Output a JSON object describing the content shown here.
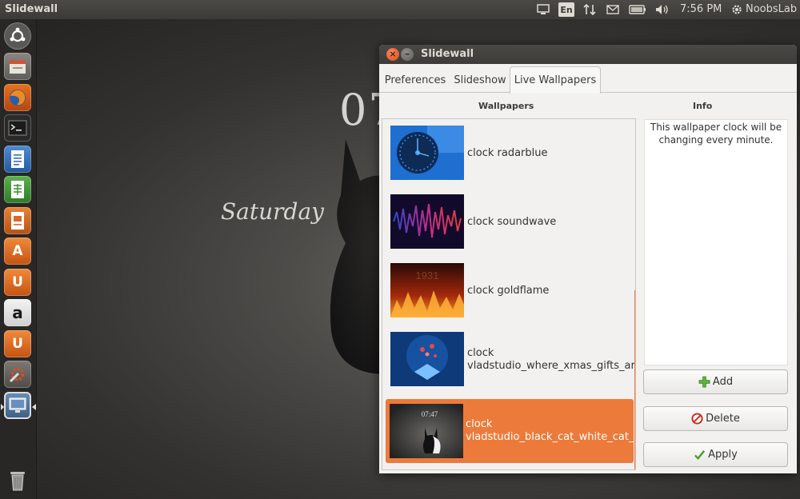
{
  "top_panel": {
    "app_name": "Slidewall",
    "keyboard_layout": "En",
    "time": "7:56 PM",
    "user": "NoobsLab",
    "icons": [
      "monitor-icon",
      "keyboard-icon",
      "network-icon",
      "mail-icon",
      "battery-icon",
      "volume-icon",
      "gear-icon"
    ]
  },
  "desktop": {
    "clock_text": "07",
    "day_text": "Saturday"
  },
  "launcher": {
    "items": [
      "dash-icon",
      "files-icon",
      "firefox-icon",
      "terminal-icon",
      "writer-icon",
      "calc-icon",
      "impress-icon",
      "software-center-icon",
      "ubuntu-one-icon",
      "amazon-icon",
      "ubuntu-one-music-icon",
      "system-settings-icon",
      "slidewall-icon",
      "trash-icon"
    ],
    "amazon_letter": "a",
    "u_letter": "U",
    "store_letter": "A"
  },
  "window": {
    "title": "Slidewall",
    "close_glyph": "×",
    "min_glyph": "–",
    "tabs": [
      {
        "label": "Preferences"
      },
      {
        "label": "Slideshow"
      },
      {
        "label": "Live Wallpapers",
        "active": true
      }
    ],
    "wallpapers_heading": "Wallpapers",
    "info_heading": "Info",
    "wallpapers": [
      {
        "label": "clock radarblue"
      },
      {
        "label": "clock soundwave"
      },
      {
        "label": "clock goldflame",
        "thumb_text": "1931"
      },
      {
        "label": "clock\nvladstudio_where_xmas_gifts_are"
      },
      {
        "label": "clock\nvladstudio_black_cat_white_cat_c",
        "selected": true,
        "thumb_text": "07:47"
      }
    ],
    "info_text": "This wallpaper clock will be changing every minute.",
    "buttons": {
      "add": "Add",
      "delete": "Delete",
      "apply": "Apply"
    }
  },
  "colors": {
    "accent": "#ec7a3b",
    "panel": "#3c3b37",
    "window_bg": "#f2f1f0"
  }
}
